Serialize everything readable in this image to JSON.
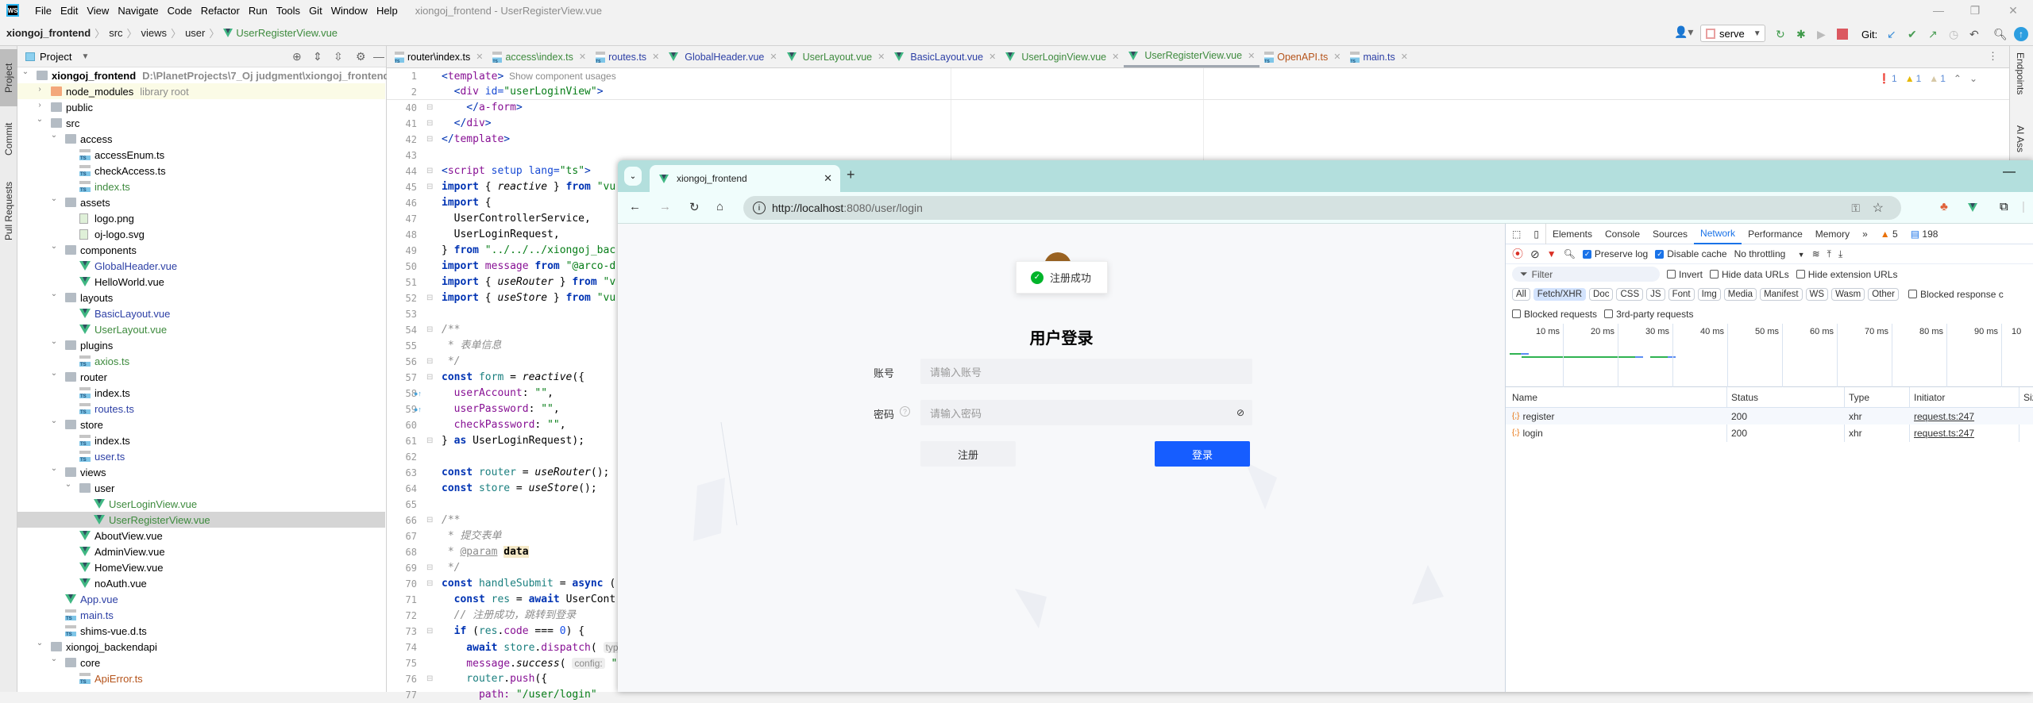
{
  "menubar": {
    "logo": "WS",
    "items": [
      "File",
      "Edit",
      "View",
      "Navigate",
      "Code",
      "Refactor",
      "Run",
      "Tools",
      "Git",
      "Window",
      "Help"
    ],
    "window_title": "xiongoj_frontend - UserRegisterView.vue"
  },
  "breadcrumb": [
    "xiongoj_frontend",
    "src",
    "views",
    "user",
    "UserRegisterView.vue"
  ],
  "toolbar": {
    "run_config": "serve",
    "git_label": "Git:"
  },
  "left_strip": [
    "Project",
    "Commit",
    "Pull Requests"
  ],
  "right_strip": [
    "Endpoints",
    "AI Ass"
  ],
  "project_panel": {
    "title": "Project",
    "tree": [
      {
        "label": "xiongoj_frontend",
        "hint": "D:\\PlanetProjects\\7_Oj judgment\\xiongoj_frontend",
        "depth": 0,
        "kind": "folder",
        "open": true,
        "color": "black",
        "bold": true
      },
      {
        "label": "node_modules",
        "hint": "library root",
        "depth": 1,
        "kind": "folder-lib",
        "open": false,
        "color": "black"
      },
      {
        "label": "public",
        "depth": 1,
        "kind": "folder",
        "open": false,
        "color": "black"
      },
      {
        "label": "src",
        "depth": 1,
        "kind": "folder",
        "open": true,
        "color": "black"
      },
      {
        "label": "access",
        "depth": 2,
        "kind": "folder",
        "open": true,
        "color": "black"
      },
      {
        "label": "accessEnum.ts",
        "depth": 3,
        "kind": "ts",
        "color": "black"
      },
      {
        "label": "checkAccess.ts",
        "depth": 3,
        "kind": "ts",
        "color": "black"
      },
      {
        "label": "index.ts",
        "depth": 3,
        "kind": "ts",
        "color": "green"
      },
      {
        "label": "assets",
        "depth": 2,
        "kind": "folder",
        "open": true,
        "color": "black"
      },
      {
        "label": "logo.png",
        "depth": 3,
        "kind": "img",
        "color": "black"
      },
      {
        "label": "oj-logo.svg",
        "depth": 3,
        "kind": "img",
        "color": "black"
      },
      {
        "label": "components",
        "depth": 2,
        "kind": "folder",
        "open": true,
        "color": "black"
      },
      {
        "label": "GlobalHeader.vue",
        "depth": 3,
        "kind": "vue",
        "color": "blue"
      },
      {
        "label": "HelloWorld.vue",
        "depth": 3,
        "kind": "vue",
        "color": "black"
      },
      {
        "label": "layouts",
        "depth": 2,
        "kind": "folder",
        "open": true,
        "color": "black"
      },
      {
        "label": "BasicLayout.vue",
        "depth": 3,
        "kind": "vue",
        "color": "blue"
      },
      {
        "label": "UserLayout.vue",
        "depth": 3,
        "kind": "vue",
        "color": "green"
      },
      {
        "label": "plugins",
        "depth": 2,
        "kind": "folder",
        "open": true,
        "color": "black"
      },
      {
        "label": "axios.ts",
        "depth": 3,
        "kind": "ts",
        "color": "green"
      },
      {
        "label": "router",
        "depth": 2,
        "kind": "folder",
        "open": true,
        "color": "black"
      },
      {
        "label": "index.ts",
        "depth": 3,
        "kind": "ts",
        "color": "black"
      },
      {
        "label": "routes.ts",
        "depth": 3,
        "kind": "ts",
        "color": "blue"
      },
      {
        "label": "store",
        "depth": 2,
        "kind": "folder",
        "open": true,
        "color": "black"
      },
      {
        "label": "index.ts",
        "depth": 3,
        "kind": "ts",
        "color": "black"
      },
      {
        "label": "user.ts",
        "depth": 3,
        "kind": "ts",
        "color": "blue"
      },
      {
        "label": "views",
        "depth": 2,
        "kind": "folder",
        "open": true,
        "color": "black"
      },
      {
        "label": "user",
        "depth": 3,
        "kind": "folder",
        "open": true,
        "color": "black"
      },
      {
        "label": "UserLoginView.vue",
        "depth": 4,
        "kind": "vue",
        "color": "green"
      },
      {
        "label": "UserRegisterView.vue",
        "depth": 4,
        "kind": "vue",
        "color": "green",
        "selected": true
      },
      {
        "label": "AboutView.vue",
        "depth": 3,
        "kind": "vue",
        "color": "black"
      },
      {
        "label": "AdminView.vue",
        "depth": 3,
        "kind": "vue",
        "color": "black"
      },
      {
        "label": "HomeView.vue",
        "depth": 3,
        "kind": "vue",
        "color": "black"
      },
      {
        "label": "noAuth.vue",
        "depth": 3,
        "kind": "vue",
        "color": "black"
      },
      {
        "label": "App.vue",
        "depth": 2,
        "kind": "vue",
        "color": "blue"
      },
      {
        "label": "main.ts",
        "depth": 2,
        "kind": "ts",
        "color": "blue"
      },
      {
        "label": "shims-vue.d.ts",
        "depth": 2,
        "kind": "ts",
        "color": "black"
      },
      {
        "label": "xiongoj_backendapi",
        "depth": 1,
        "kind": "folder",
        "open": true,
        "color": "black"
      },
      {
        "label": "core",
        "depth": 2,
        "kind": "folder",
        "open": true,
        "color": "black"
      },
      {
        "label": "ApiError.ts",
        "depth": 3,
        "kind": "ts",
        "color": "brown"
      }
    ]
  },
  "colors": {
    "green": "#3d8a3d",
    "blue": "#2c3fa5",
    "brown": "#b5531a",
    "black": "#000000",
    "primary_button": "#165dff",
    "success": "#00b42a",
    "browser_frame": "#b3dfdd"
  },
  "editor": {
    "tabs": [
      {
        "label": "router\\index.ts",
        "kind": "ts",
        "color": "black"
      },
      {
        "label": "access\\index.ts",
        "kind": "ts",
        "color": "green"
      },
      {
        "label": "routes.ts",
        "kind": "ts",
        "color": "blue"
      },
      {
        "label": "GlobalHeader.vue",
        "kind": "vue",
        "color": "blue"
      },
      {
        "label": "UserLayout.vue",
        "kind": "vue",
        "color": "green"
      },
      {
        "label": "BasicLayout.vue",
        "kind": "vue",
        "color": "blue"
      },
      {
        "label": "UserLoginView.vue",
        "kind": "vue",
        "color": "green"
      },
      {
        "label": "UserRegisterView.vue",
        "kind": "vue",
        "color": "green",
        "active": true
      },
      {
        "label": "OpenAPI.ts",
        "kind": "ts",
        "color": "brown"
      },
      {
        "label": "main.ts",
        "kind": "ts",
        "color": "blue"
      }
    ],
    "inspections": {
      "errors": "1",
      "warnings": "1",
      "weak_warnings": "1"
    },
    "lines": [
      {
        "n": "1",
        "t": [
          [
            "<",
            "br"
          ],
          [
            "template",
            "tag"
          ],
          [
            ">",
            "br"
          ],
          [
            "  Show component usages",
            "hintplain"
          ]
        ]
      },
      {
        "n": "2",
        "t": [
          [
            "  <",
            "br"
          ],
          [
            "div ",
            "tag"
          ],
          [
            "id=",
            "attr"
          ],
          [
            "\"userLoginView\"",
            "str"
          ],
          [
            ">",
            "br"
          ]
        ]
      },
      {
        "n": "40",
        "t": [
          [
            "    </",
            "br"
          ],
          [
            "a-form",
            "tag"
          ],
          [
            ">",
            "br"
          ]
        ]
      },
      {
        "n": "41",
        "t": [
          [
            "  </",
            "br"
          ],
          [
            "div",
            "tag"
          ],
          [
            ">",
            "br"
          ]
        ]
      },
      {
        "n": "42",
        "t": [
          [
            "</",
            "br"
          ],
          [
            "template",
            "tag"
          ],
          [
            ">",
            "br"
          ]
        ]
      },
      {
        "n": "43",
        "t": []
      },
      {
        "n": "44",
        "t": [
          [
            "<",
            "br"
          ],
          [
            "script ",
            "tag"
          ],
          [
            "setup ",
            "attr"
          ],
          [
            "lang=",
            "attr"
          ],
          [
            "\"ts\"",
            "str"
          ],
          [
            ">",
            "br"
          ]
        ]
      },
      {
        "n": "45",
        "t": [
          [
            "import ",
            "kw"
          ],
          [
            "{ ",
            ""
          ],
          [
            "reactive",
            "fn"
          ],
          [
            " } ",
            ""
          ],
          [
            "from ",
            "kw"
          ],
          [
            "\"vu",
            "str"
          ]
        ]
      },
      {
        "n": "46",
        "t": [
          [
            "import ",
            "kw"
          ],
          [
            "{",
            ""
          ]
        ]
      },
      {
        "n": "47",
        "t": [
          [
            "  UserControllerService,",
            ""
          ]
        ]
      },
      {
        "n": "48",
        "t": [
          [
            "  UserLoginRequest,",
            ""
          ]
        ]
      },
      {
        "n": "49",
        "t": [
          [
            "} ",
            ""
          ],
          [
            "from ",
            "kw"
          ],
          [
            "\"../../../xiongoj_bac",
            "str"
          ]
        ]
      },
      {
        "n": "50",
        "t": [
          [
            "import ",
            "kw"
          ],
          [
            "message ",
            "prop"
          ],
          [
            "from ",
            "kw"
          ],
          [
            "\"@arco-d",
            "str"
          ]
        ]
      },
      {
        "n": "51",
        "t": [
          [
            "import ",
            "kw"
          ],
          [
            "{ ",
            ""
          ],
          [
            "useRouter",
            "fn"
          ],
          [
            " } ",
            ""
          ],
          [
            "from ",
            "kw"
          ],
          [
            "\"v",
            "str"
          ]
        ]
      },
      {
        "n": "52",
        "t": [
          [
            "import ",
            "kw"
          ],
          [
            "{ ",
            ""
          ],
          [
            "useStore",
            "fn"
          ],
          [
            " } ",
            ""
          ],
          [
            "from ",
            "kw"
          ],
          [
            "\"vu",
            "str"
          ]
        ]
      },
      {
        "n": "53",
        "t": []
      },
      {
        "n": "54",
        "t": [
          [
            "/**",
            "cm"
          ]
        ]
      },
      {
        "n": "55",
        "t": [
          [
            " * 表单信息",
            "cm"
          ]
        ]
      },
      {
        "n": "56",
        "t": [
          [
            " */",
            "cm"
          ]
        ]
      },
      {
        "n": "57",
        "t": [
          [
            "const ",
            "kw"
          ],
          [
            "form",
            "var"
          ],
          [
            " = ",
            ""
          ],
          [
            "reactive",
            "fn"
          ],
          [
            "({",
            ""
          ]
        ]
      },
      {
        "n": "58",
        "t": [
          [
            "  userAccount",
            "prop"
          ],
          [
            ": ",
            ""
          ],
          [
            "\"\"",
            "str"
          ],
          [
            ",",
            ""
          ]
        ]
      },
      {
        "n": "59",
        "t": [
          [
            "  userPassword",
            "prop"
          ],
          [
            ": ",
            ""
          ],
          [
            "\"\"",
            "str"
          ],
          [
            ",",
            ""
          ]
        ]
      },
      {
        "n": "60",
        "t": [
          [
            "  checkPassword",
            "prop"
          ],
          [
            ": ",
            ""
          ],
          [
            "\"\"",
            "str"
          ],
          [
            ",",
            ""
          ]
        ]
      },
      {
        "n": "61",
        "t": [
          [
            "} ",
            ""
          ],
          [
            "as ",
            "kw"
          ],
          [
            "UserLoginRequest);",
            ""
          ]
        ]
      },
      {
        "n": "62",
        "t": []
      },
      {
        "n": "63",
        "t": [
          [
            "const ",
            "kw"
          ],
          [
            "router",
            "var"
          ],
          [
            " = ",
            ""
          ],
          [
            "useRouter",
            "fn"
          ],
          [
            "();",
            ""
          ]
        ]
      },
      {
        "n": "64",
        "t": [
          [
            "const ",
            "kw"
          ],
          [
            "store",
            "var"
          ],
          [
            " = ",
            ""
          ],
          [
            "useStore",
            "fn"
          ],
          [
            "();",
            ""
          ]
        ]
      },
      {
        "n": "65",
        "t": []
      },
      {
        "n": "66",
        "t": [
          [
            "/**",
            "cm"
          ]
        ]
      },
      {
        "n": "67",
        "t": [
          [
            " * 提交表单",
            "cm"
          ]
        ]
      },
      {
        "n": "68",
        "t": [
          [
            " * ",
            "cm"
          ],
          [
            "@param",
            "doc"
          ],
          [
            " ",
            ""
          ],
          [
            "data",
            "hl"
          ]
        ]
      },
      {
        "n": "69",
        "t": [
          [
            " */",
            "cm"
          ]
        ]
      },
      {
        "n": "70",
        "t": [
          [
            "const ",
            "kw"
          ],
          [
            "handleSubmit",
            "var"
          ],
          [
            " = ",
            ""
          ],
          [
            "async ",
            "kw"
          ],
          [
            "(",
            ""
          ]
        ]
      },
      {
        "n": "71",
        "t": [
          [
            "  const ",
            "kw"
          ],
          [
            "res",
            "var"
          ],
          [
            " = ",
            ""
          ],
          [
            "await ",
            "kw"
          ],
          [
            "UserCont",
            ""
          ]
        ]
      },
      {
        "n": "72",
        "t": [
          [
            "  // 注册成功，跳转到登录",
            "cm"
          ]
        ]
      },
      {
        "n": "73",
        "t": [
          [
            "  if ",
            "kw"
          ],
          [
            "(",
            ""
          ],
          [
            "res",
            "var"
          ],
          [
            ".",
            ""
          ],
          [
            "code",
            "prop"
          ],
          [
            " === ",
            ""
          ],
          [
            "0",
            "num"
          ],
          [
            ") {",
            ""
          ]
        ]
      },
      {
        "n": "74",
        "t": [
          [
            "    await ",
            "kw"
          ],
          [
            "store",
            "var"
          ],
          [
            ".",
            ""
          ],
          [
            "dispatch",
            "prop"
          ],
          [
            "( ",
            ""
          ],
          [
            "typ",
            "hint"
          ]
        ]
      },
      {
        "n": "75",
        "t": [
          [
            "    message",
            "prop"
          ],
          [
            ".",
            ""
          ],
          [
            "success",
            "fn"
          ],
          [
            "( ",
            ""
          ],
          [
            "config:",
            "hint"
          ],
          [
            " \"",
            "str"
          ]
        ]
      },
      {
        "n": "76",
        "t": [
          [
            "    router",
            "var"
          ],
          [
            ".",
            ""
          ],
          [
            "push",
            "prop"
          ],
          [
            "({",
            ""
          ]
        ]
      },
      {
        "n": "77",
        "t": [
          [
            "      path: ",
            "prop"
          ],
          [
            "\"/user/login\"",
            "str"
          ]
        ]
      }
    ]
  },
  "browser": {
    "tab_title": "xiongoj_frontend",
    "url_host": "http://localhost",
    "url_rest": ":8080/user/login",
    "page": {
      "toast": "注册成功",
      "title": "用户登录",
      "account_label": "账号",
      "account_placeholder": "请输入账号",
      "password_label": "密码",
      "password_placeholder": "请输入密码",
      "register_button": "注册",
      "login_button": "登录"
    },
    "devtools": {
      "tabs": [
        "Elements",
        "Console",
        "Sources",
        "Network",
        "Performance",
        "Memory"
      ],
      "active_tab": "Network",
      "warnings": "5",
      "messages": "198",
      "preserve_log": "Preserve log",
      "disable_cache": "Disable cache",
      "throttling": "No throttling",
      "filter_placeholder": "Filter",
      "invert": "Invert",
      "hide_data_urls": "Hide data URLs",
      "hide_extension_urls": "Hide extension URLs",
      "chips": [
        "All",
        "Fetch/XHR",
        "Doc",
        "CSS",
        "JS",
        "Font",
        "Img",
        "Media",
        "Manifest",
        "WS",
        "Wasm",
        "Other"
      ],
      "active_chip": "Fetch/XHR",
      "blocked_response": "Blocked response c",
      "blocked_requests": "Blocked requests",
      "third_party": "3rd-party requests",
      "timeline_ticks": [
        "10 ms",
        "20 ms",
        "30 ms",
        "40 ms",
        "50 ms",
        "60 ms",
        "70 ms",
        "80 ms",
        "90 ms",
        "10"
      ],
      "columns": [
        "Name",
        "Status",
        "Type",
        "Initiator",
        "Siz"
      ],
      "rows": [
        {
          "name": "register",
          "status": "200",
          "type": "xhr",
          "initiator": "request.ts:247"
        },
        {
          "name": "login",
          "status": "200",
          "type": "xhr",
          "initiator": "request.ts:247"
        }
      ]
    }
  }
}
